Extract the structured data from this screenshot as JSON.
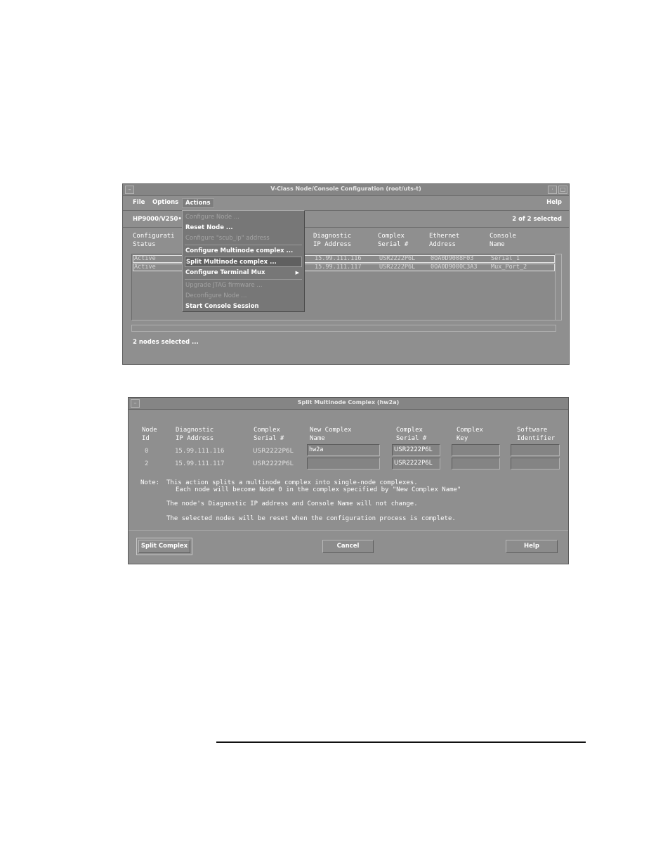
{
  "window1": {
    "title": "V-Class Node/Console Configuration  (root/uts-t)",
    "menu": {
      "file": "File",
      "options": "Options",
      "actions": "Actions",
      "help": "Help"
    },
    "system_label": "HP9000/V250•",
    "selection_count": "2 of 2 selected",
    "columns": {
      "config": "Configurati\nStatus",
      "diag": "Diagnostic\nIP Address",
      "serial": "Complex\nSerial #",
      "ethernet": "Ethernet\nAddress",
      "console": "Console\nName"
    },
    "rows": [
      {
        "status": "Active",
        "diag": "15.99.111.116",
        "serial": "USR2222P6L",
        "ethernet": "0OA0D9008F03",
        "console": "Serial_1"
      },
      {
        "status": "Active",
        "diag": "15.99.111.117",
        "serial": "USR2222P6L",
        "ethernet": "0OA0D9000C3A3",
        "console": "Mux_Port_2"
      }
    ],
    "status_text": "2 nodes selected ...",
    "actions_menu": [
      "Configure Node ...",
      "Reset Node ...",
      "Configure \"scub_ip\" address",
      "Configure Multinode complex ...",
      "Split Multinode complex ...",
      "Configure Terminal Mux",
      "Upgrade JTAG firmware ...",
      "Deconfigure Node ...",
      "Start Console Session"
    ]
  },
  "window2": {
    "title": "Split Multinode Complex (hw2a)",
    "headers": {
      "node": "Node\nId",
      "diag": "Diagnostic\nIP Address",
      "serial": "Complex\nSerial #",
      "newname": "New Complex\nName",
      "newserial": "Complex\nSerial #",
      "key": "Complex\nKey",
      "software": "Software\nIdentifier"
    },
    "rows": [
      {
        "id": "0",
        "diag": "15.99.111.116",
        "serial": "USR2222P6L",
        "new_name": "hw2a",
        "new_serial": "USR2222P6L",
        "key": "",
        "software": ""
      },
      {
        "id": "2",
        "diag": "15.99.111.117",
        "serial": "USR2222P6L",
        "new_name": "",
        "new_serial": "USR2222P6L",
        "key": "",
        "software": ""
      }
    ],
    "note": {
      "label": "Note:",
      "line1": "This action splits a multinode complex into single-node complexes.",
      "line2": "Each node will become Node 0 in the complex specified by \"New Complex Name\"",
      "line3": "The node's Diagnostic IP address and Console Name will not change.",
      "line4": "The selected nodes will be reset when the configuration process is complete."
    },
    "buttons": {
      "split": "Split Complex",
      "cancel": "Cancel",
      "help": "Help"
    }
  },
  "colors": {
    "window_bg": "#8f8f8f",
    "title_bg": "#858585",
    "text": "#ffffff"
  }
}
